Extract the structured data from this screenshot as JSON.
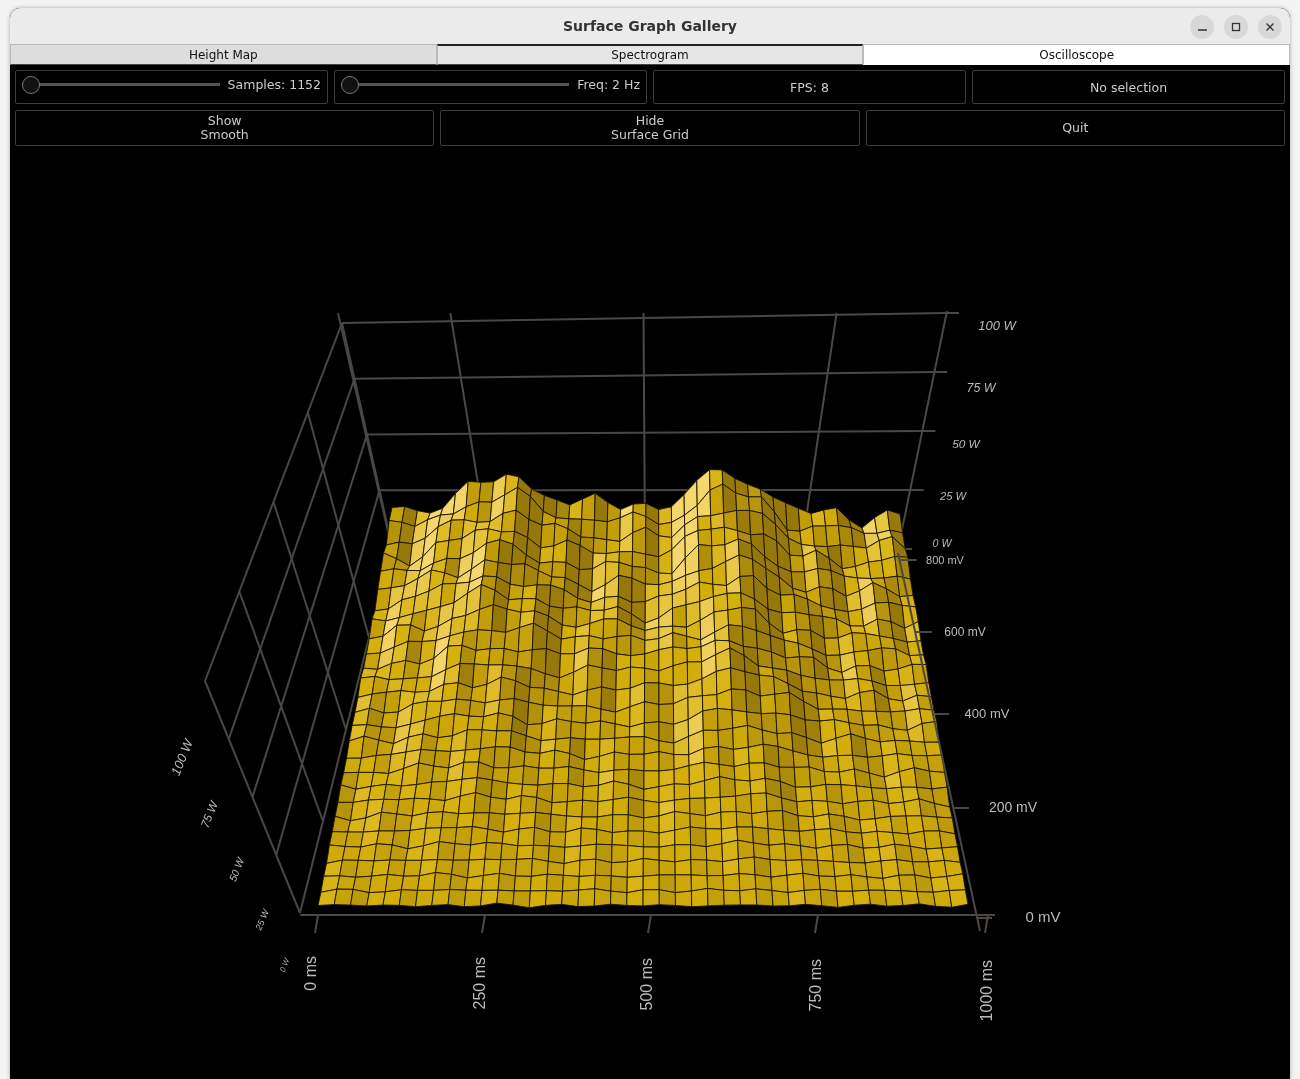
{
  "window": {
    "title": "Surface Graph Gallery"
  },
  "tabs": [
    {
      "label": "Height Map",
      "selected": false,
      "hovered": false
    },
    {
      "label": "Spectrogram",
      "selected": false,
      "hovered": true
    },
    {
      "label": "Oscilloscope",
      "selected": true,
      "hovered": false
    }
  ],
  "controls": [
    {
      "kind": "slider",
      "label": "Samples: 1152",
      "level": 0
    },
    {
      "kind": "slider",
      "label": "Freq: 2 Hz",
      "level": 0
    },
    {
      "kind": "readout",
      "label": "FPS: 8"
    },
    {
      "kind": "readout",
      "label": "No selection"
    }
  ],
  "buttons": [
    {
      "lines": [
        "Show",
        "Smooth"
      ]
    },
    {
      "lines": [
        "Hide",
        "Surface Grid"
      ]
    },
    {
      "lines": [
        "Quit"
      ]
    }
  ],
  "graph": {
    "power_labels_right": [
      "100 W",
      "75 W",
      "50 W",
      "25 W",
      "0 W"
    ],
    "voltage_labels": [
      "800 mV",
      "600 mV",
      "400 mV",
      "200 mV",
      "0 mV"
    ],
    "time_labels": [
      "0 ms",
      "250 ms",
      "500 ms",
      "750 ms",
      "1000 ms"
    ],
    "power_labels_left": [
      "100 W",
      "75 W",
      "50 W",
      "25 W",
      "0 W"
    ]
  }
}
